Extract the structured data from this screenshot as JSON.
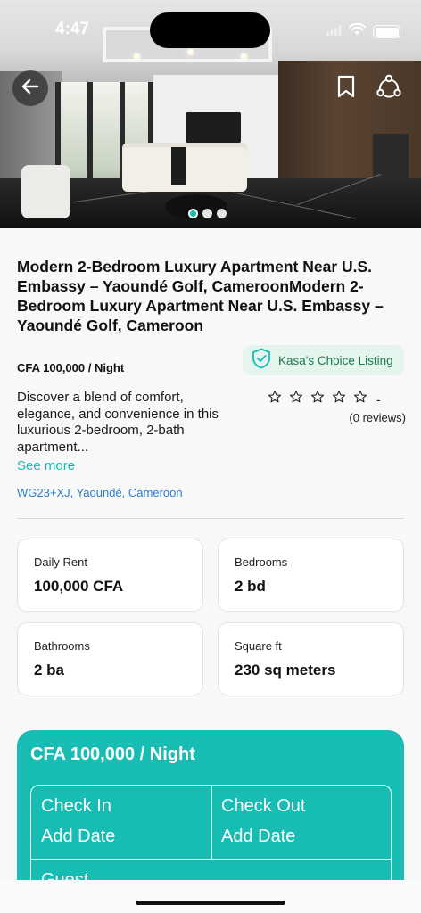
{
  "status_bar": {
    "time": "4:47"
  },
  "hero": {
    "photo_description": "living-room-photo",
    "page_indicator": {
      "count": 3,
      "active_index": 0
    }
  },
  "listing": {
    "title": " Modern 2-Bedroom Luxury Apartment Near U.S. Embassy – Yaoundé Golf, CameroonModern 2-Bedroom Luxury Apartment Near U.S. Embassy – Yaoundé Golf, Cameroon",
    "price_night": "CFA 100,000 / Night",
    "badge": "Kasa's Choice Listing",
    "description": "Discover a blend of comfort, elegance, and convenience in this luxurious 2-bedroom, 2-bath apartment...",
    "see_more": "See more",
    "rating_value": "-",
    "reviews": "(0 reviews)",
    "address": "WG23+XJ, Yaoundé, Cameroon"
  },
  "stats": {
    "daily_rent_label": "Daily Rent",
    "daily_rent_value": "100,000 CFA",
    "bedrooms_label": "Bedrooms",
    "bedrooms_value": "2 bd",
    "bathrooms_label": "Bathrooms",
    "bathrooms_value": "2 ba",
    "sqft_label": "Square ft",
    "sqft_value": "230 sq meters"
  },
  "booking": {
    "price": "CFA 100,000 / Night",
    "check_in_label": "Check In",
    "check_in_value": "Add Date",
    "check_out_label": "Check Out",
    "check_out_value": "Add Date",
    "guest_label": "Guest"
  },
  "colors": {
    "accent": "#17bdb3",
    "badge_bg": "#e3f5ec",
    "badge_text": "#1c7a4f",
    "link": "#2b7cd3"
  }
}
